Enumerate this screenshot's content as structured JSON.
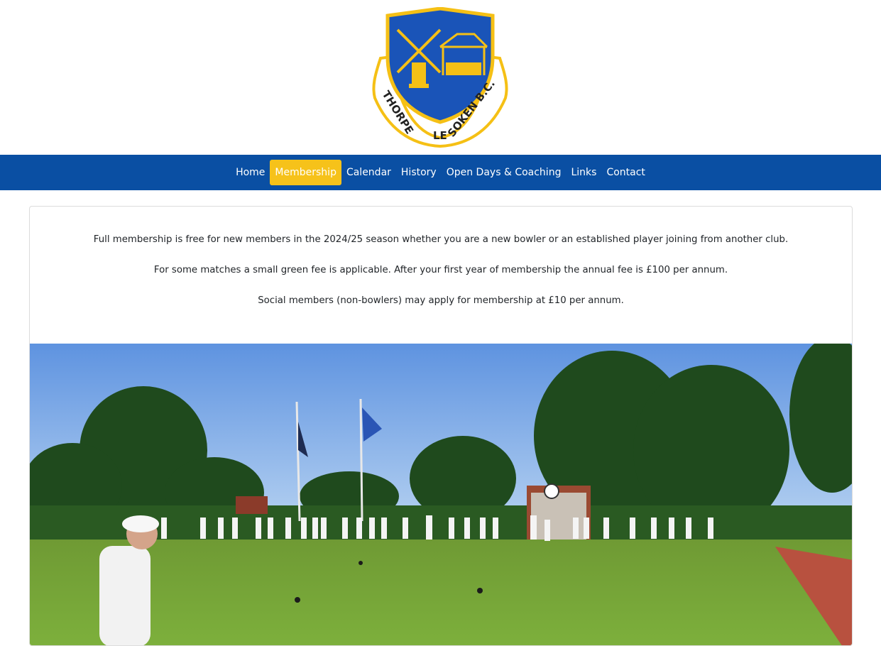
{
  "logo": {
    "text_top": "THORPE",
    "text_middle": "LE",
    "text_bottom": "SOKEN B.C.",
    "colors": {
      "shield": "#1a54b8",
      "gold": "#f5c015",
      "outline": "#222222"
    }
  },
  "nav": {
    "items": [
      {
        "label": "Home",
        "active": false
      },
      {
        "label": "Membership",
        "active": true
      },
      {
        "label": "Calendar",
        "active": false
      },
      {
        "label": "History",
        "active": false
      },
      {
        "label": "Open Days & Coaching",
        "active": false
      },
      {
        "label": "Links",
        "active": false
      },
      {
        "label": "Contact",
        "active": false
      }
    ],
    "colors": {
      "bar": "#0a4fa3",
      "active": "#f6c21a"
    }
  },
  "content": {
    "paragraphs": [
      "Full membership is free for new members in the 2024/25 season whether you are a new bowler or an established player joining from another club.",
      "For some matches a small green fee is applicable. After your first year of membership the annual fee is £100 per annum.",
      "Social members (non-bowlers) may apply for membership at £10 per annum."
    ]
  }
}
